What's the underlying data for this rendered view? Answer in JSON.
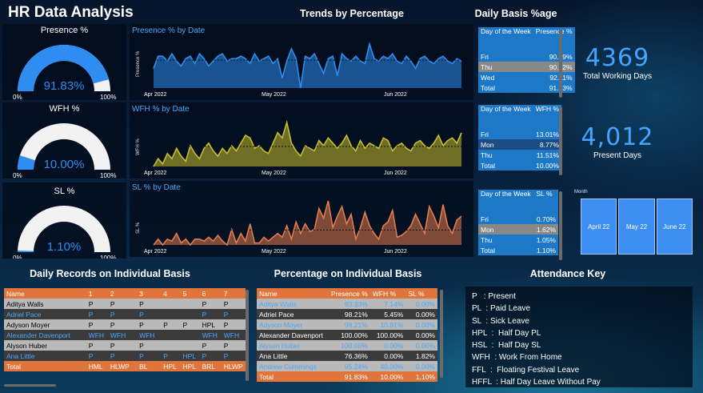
{
  "title": "HR Data  Analysis",
  "sections": {
    "trends": "Trends by Percentage",
    "daily_basis": "Daily Basis %age",
    "daily_records": "Daily Records on Individual Basis",
    "percentage_individual": "Percentage on Individual Basis",
    "attendance_key": "Attendance Key"
  },
  "gauges": [
    {
      "title": "Presence %",
      "value": "91.83%",
      "fraction": 0.9183,
      "min": "0%",
      "max": "100%"
    },
    {
      "title": "WFH %",
      "value": "10.00%",
      "fraction": 0.1,
      "min": "0%",
      "max": "100%"
    },
    {
      "title": "SL %",
      "value": "1.10%",
      "fraction": 0.011,
      "min": "0%",
      "max": "100%"
    }
  ],
  "colors": {
    "presence": "#2e8df0",
    "wfh": "#c8bd2e",
    "sl": "#e37b4d",
    "accent": "#46a4ff",
    "header": "#e0743a"
  },
  "chart_data": [
    {
      "type": "area",
      "title": "Presence % by Date",
      "ylabel": "Presence %",
      "x_ticks": [
        "Apr 2022",
        "May 2022",
        "Jun 2022"
      ],
      "values": [
        88,
        93,
        93,
        91,
        94,
        91,
        89,
        92,
        93,
        90,
        94,
        92,
        89,
        91,
        93,
        94,
        91,
        92,
        92,
        93,
        92,
        90,
        94,
        91,
        92,
        93,
        90,
        92,
        84,
        91,
        96,
        92,
        80,
        93,
        92,
        94,
        90,
        86,
        92,
        93,
        85,
        94,
        92,
        91,
        93,
        91,
        90,
        98,
        92,
        91,
        93,
        92,
        94,
        91,
        90,
        93,
        91,
        88,
        92,
        93,
        91,
        90,
        92,
        93,
        91,
        90,
        92,
        91
      ]
    },
    {
      "type": "area",
      "title": "WFH % by Date",
      "ylabel": "WFH %",
      "x_ticks": [
        "Apr 2022",
        "May 2022",
        "Jun 2022"
      ],
      "values": [
        3,
        6,
        4,
        8,
        6,
        10,
        7,
        5,
        11,
        8,
        6,
        10,
        12,
        9,
        7,
        10,
        8,
        11,
        9,
        12,
        15,
        14,
        10,
        11,
        9,
        8,
        12,
        16,
        14,
        20,
        12,
        9,
        7,
        11,
        10,
        9,
        13,
        11,
        14,
        12,
        10,
        12,
        15,
        11,
        9,
        13,
        10,
        12,
        11,
        10,
        14,
        13,
        9,
        11,
        12,
        10,
        9,
        12,
        13,
        11,
        10,
        12,
        15,
        11,
        13,
        14,
        12,
        16
      ]
    },
    {
      "type": "area",
      "title": "SL % by Date",
      "ylabel": "SL %",
      "x_ticks": [
        "Apr 2022",
        "May 2022",
        "Jun 2022"
      ],
      "values": [
        0.3,
        0.6,
        0.3,
        0.6,
        0.5,
        0.9,
        0.4,
        0.6,
        0.3,
        0.6,
        0.6,
        0.5,
        0.7,
        0.5,
        0.8,
        0.5,
        0.3,
        1.1,
        0.4,
        0.9,
        0.5,
        1.4,
        0.4,
        0.4,
        0.7,
        0.5,
        0.7,
        0.9,
        0.7,
        1.3,
        0.6,
        1.5,
        0.9,
        1.4,
        1.0,
        1.1,
        2.2,
        1.7,
        2.6,
        1.2,
        1.8,
        2.3,
        1.4,
        1.9,
        0.6,
        1.2,
        2.0,
        1.3,
        0.9,
        0.6,
        1.3,
        1.5,
        2.1,
        0.7,
        0.8,
        1.0,
        1.3,
        1.9,
        1.4,
        0.9,
        2.3,
        1.8,
        1.2,
        2.4,
        1.3,
        0.9,
        1.6,
        1.8
      ]
    }
  ],
  "daily_basis": [
    {
      "col1": "Day of the Week",
      "col2": "Presence %",
      "rows": [
        [
          "Fri",
          "90.19%"
        ],
        [
          "Thu",
          "90.72%"
        ],
        [
          "Wed",
          "92.11%"
        ]
      ],
      "total": [
        "Total",
        "91.83%"
      ]
    },
    {
      "col1": "Day of the Week",
      "col2": "WFH %",
      "rows": [
        [
          "Fri",
          "13.01%"
        ],
        [
          "Mon",
          "8.77%"
        ],
        [
          "Thu",
          "11.51%"
        ]
      ],
      "total": [
        "Total",
        "10.00%"
      ]
    },
    {
      "col1": "Day of the Week",
      "col2": "SL %",
      "rows": [
        [
          "Fri",
          "0.70%"
        ],
        [
          "Mon",
          "1.62%"
        ],
        [
          "Thu",
          "1.05%"
        ]
      ],
      "total": [
        "Total",
        "1.10%"
      ]
    }
  ],
  "cards": [
    {
      "value": "4369",
      "label": "Total Working Days"
    },
    {
      "value": "4,012",
      "label": "Present Days"
    }
  ],
  "month_tiles": {
    "label": "Month",
    "items": [
      "April 22",
      "May 22",
      "June 22"
    ]
  },
  "daily_records": {
    "headers": [
      "Name",
      "1",
      "2",
      "3",
      "4",
      "5",
      "6",
      "7"
    ],
    "rows": [
      [
        "Aditya Walls",
        "P",
        "P",
        "P",
        "",
        "",
        "P",
        "P"
      ],
      [
        "Adriel Pace",
        "P",
        "P",
        "P",
        "",
        "",
        "P",
        "P"
      ],
      [
        "Adyson Moyer",
        "P",
        "P",
        "P",
        "P",
        "P",
        "HPL",
        "P"
      ],
      [
        "Alexander Davenport",
        "WFH",
        "WFH",
        "WFH",
        "",
        "",
        "WFH",
        "WFH"
      ],
      [
        "Alyson Huber",
        "P",
        "P",
        "P",
        "",
        "",
        "P",
        "P"
      ],
      [
        "Ana Little",
        "P",
        "P",
        "P",
        "P",
        "HPL",
        "P",
        "P"
      ]
    ],
    "total": [
      "Total",
      "HML",
      "HLWP",
      "BL",
      "HPL",
      "HPL",
      "BRL",
      "HLWP"
    ]
  },
  "percentage_individual": {
    "headers": [
      "Name",
      "Presence %",
      "WFH %",
      "SL %"
    ],
    "rows": [
      [
        "Aditya Walls",
        "93.33%",
        "7.14%",
        "0.00%"
      ],
      [
        "Adriel Pace",
        "98.21%",
        "5.45%",
        "0.00%"
      ],
      [
        "Adyson Moyer",
        "98.21%",
        "10.91%",
        "0.00%"
      ],
      [
        "Alexander Davenport",
        "100.00%",
        "100.00%",
        "0.00%"
      ],
      [
        "Alyson Huber",
        "100.00%",
        "0.00%",
        "0.00%"
      ],
      [
        "Ana Little",
        "76.36%",
        "0.00%",
        "1.82%"
      ],
      [
        "Andrew Cummings",
        "95.24%",
        "40.00%",
        "0.00%"
      ]
    ],
    "total": [
      "Total",
      "91.83%",
      "10.00%",
      "1.10%"
    ]
  },
  "attendance_key": [
    "P   : Present",
    "PL  : Paid Leave",
    "SL  : Sick Leave",
    "HPL  :  Half Day PL",
    "HSL  :  Half Day SL",
    "WFH  : Work From Home",
    "FFL  :  Floating Festival Leave",
    "HFFL  : Half Day Leave Without Pay"
  ]
}
